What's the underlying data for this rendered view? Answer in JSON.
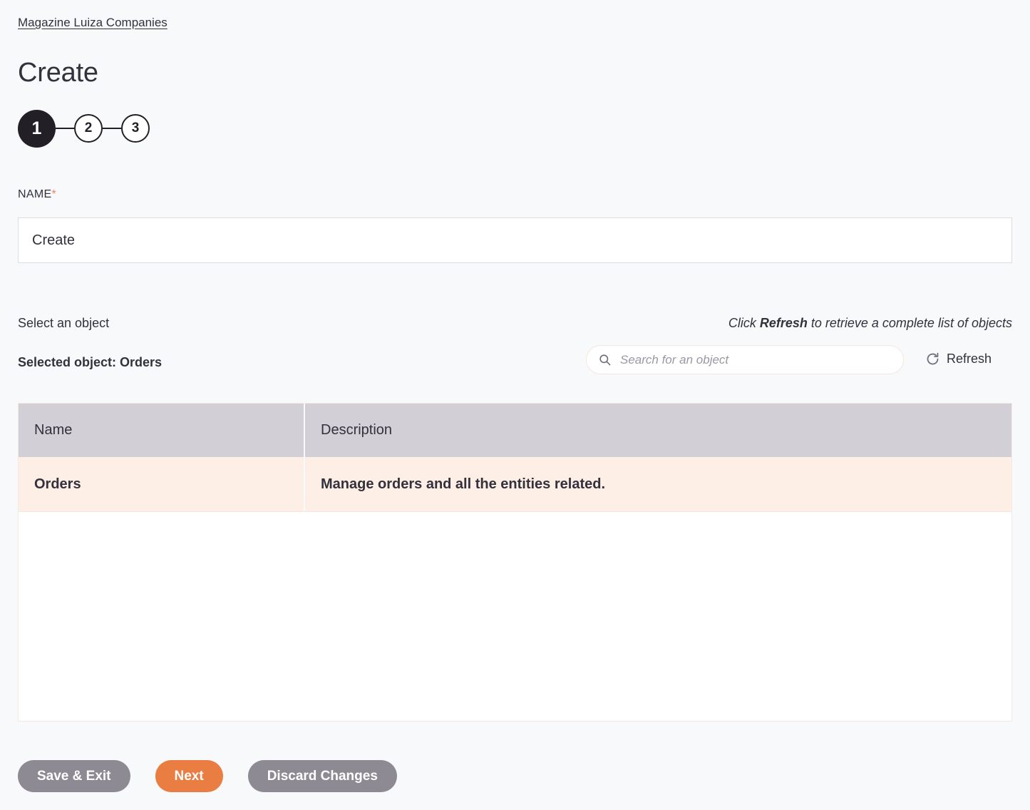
{
  "breadcrumb": {
    "label": "Magazine Luiza Companies"
  },
  "page": {
    "title": "Create"
  },
  "stepper": {
    "steps": [
      {
        "number": "1",
        "state": "active"
      },
      {
        "number": "2",
        "state": "idle"
      },
      {
        "number": "3",
        "state": "idle"
      }
    ]
  },
  "name_field": {
    "label": "NAME",
    "required_marker": "*",
    "value": "Create",
    "placeholder": ""
  },
  "object_section": {
    "select_label": "Select an object",
    "hint_prefix": "Click ",
    "hint_bold": "Refresh",
    "hint_suffix": " to retrieve a complete list of objects",
    "selected_object": "Selected object: Orders",
    "search_placeholder": "Search for an object",
    "search_value": "",
    "search_icon": "search-icon",
    "refresh_label": "Refresh",
    "refresh_icon": "refresh-icon"
  },
  "table": {
    "columns": [
      "Name",
      "Description"
    ],
    "rows": [
      {
        "name": "Orders",
        "description": "Manage orders and all the entities related.",
        "selected": true
      }
    ]
  },
  "footer": {
    "save_exit_label": "Save & Exit",
    "next_label": "Next",
    "discard_label": "Discard Changes"
  },
  "colors": {
    "page_background": "#f8f9fb",
    "accent_orange": "#ea7d41",
    "required_asterisk": "#ef8354",
    "button_grey": "#8d8a93",
    "step_active": "#231f27",
    "table_header": "#d2d0d6",
    "row_selected": "#fdeee6",
    "text": "#32313c"
  }
}
